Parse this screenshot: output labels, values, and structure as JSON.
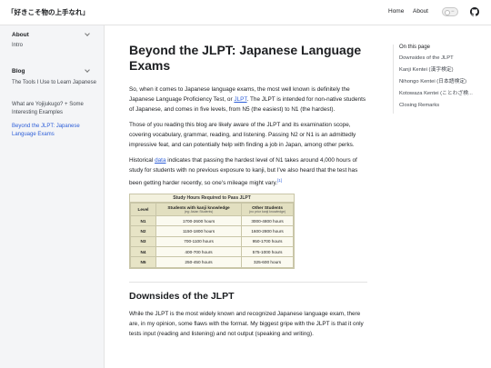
{
  "header": {
    "site_title": "「好きこそ物の上手なれ」",
    "nav": [
      "Home",
      "About"
    ]
  },
  "sidebar": {
    "about": {
      "label": "About",
      "items": [
        "Intro"
      ]
    },
    "blog": {
      "label": "Blog",
      "items": [
        "The Tools I Use to Learn Japanese",
        "What are Yojijukugo? + Some Interesting Examples",
        "Beyond the JLPT: Japanese Language Exams"
      ]
    }
  },
  "article": {
    "title": "Beyond the JLPT: Japanese Language Exams",
    "p1_before": "So, when it comes to Japanese language exams, the most well known is definitely the Japanese Language Proficiency Test, or ",
    "p1_link": "JLPT",
    "p1_after": ". The JLPT is intended for non-native students of Japanese, and comes in five levels, from N5 (the easiest) to N1 (the hardest).",
    "p2": "Those of you reading this blog are likely aware of the JLPT and its examination scope, covering vocabulary, grammar, reading, and listening. Passing N2 or N1 is an admittedly impressive feat, and can potentially help with finding a job in Japan, among other perks.",
    "p3_before": "Historical ",
    "p3_link": "data",
    "p3_after": " indicates that passing the hardest level of N1 takes around 4,000 hours of study for students with no previous exposure to kanji, but I've also heard that the test has been getting harder recently, so one's mileage might vary.",
    "p3_footnote": "[1]",
    "table": {
      "caption": "Study Hours Required to Pass JLPT",
      "headers": [
        {
          "main": "Level",
          "sub": ""
        },
        {
          "main": "Students with kanji knowledge",
          "sub": "(eg: Asian Students)"
        },
        {
          "main": "Other Students",
          "sub": "(no prior kanji knowledge)"
        }
      ],
      "rows": [
        [
          "N1",
          "1700-2600 hours",
          "3000-4800 hours"
        ],
        [
          "N2",
          "1150-1800 hours",
          "1600-2800 hours"
        ],
        [
          "N3",
          "700-1100 hours",
          "950-1700 hours"
        ],
        [
          "N4",
          "400-700 hours",
          "575-1000 hours"
        ],
        [
          "N5",
          "250-450 hours",
          "325-600 hours"
        ]
      ]
    },
    "h2": "Downsides of the JLPT",
    "p4": "While the JLPT is the most widely known and recognized Japanese language exam, there are, in my opinion, some flaws with the format. My biggest gripe with the JLPT is that it only tests input (reading and listening) and not output (speaking and writing)."
  },
  "toc": {
    "title": "On this page",
    "items": [
      "Downsides of the JLPT",
      "Kanji Kentei (漢字検定)",
      "Nihongo Kentei (日本語検定)",
      "Kotowaza Kentei (ことわざ検...",
      "Closing Remarks"
    ]
  },
  "colors": {
    "accent": "#2e5fd8",
    "sidebar_bg": "#f4f5f7",
    "table_bg": "#f3f1de"
  },
  "icons": {
    "theme": "theme-toggle-icon",
    "repo": "github-icon"
  }
}
